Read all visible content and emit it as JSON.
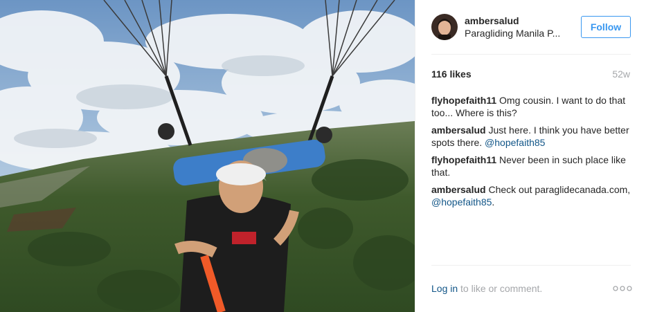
{
  "author": {
    "username": "ambersalud",
    "location": "Paragliding Manila P..."
  },
  "follow_label": "Follow",
  "likes": "116 likes",
  "age": "52w",
  "comments": [
    {
      "user": "flyhopefaith11",
      "text": "Omg cousin. I want to do that too... Where is this?",
      "mention": ""
    },
    {
      "user": "ambersalud",
      "text": "Just here. I think you have better spots there.",
      "mention": "@hopefaith85"
    },
    {
      "user": "flyhopefaith11",
      "text": "Never been in such place like that.",
      "mention": ""
    },
    {
      "user": "ambersalud",
      "text": "Check out paraglidecanada.com,",
      "mention": "@hopefaith85",
      "suffix": "."
    }
  ],
  "footer": {
    "login_label": "Log in",
    "rest": "to like or comment."
  },
  "icons": {
    "more": "more-options-icon",
    "avatar": "profile-avatar"
  },
  "colors": {
    "accent": "#3897f0",
    "link": "#125688",
    "muted": "#a5a7aa"
  }
}
